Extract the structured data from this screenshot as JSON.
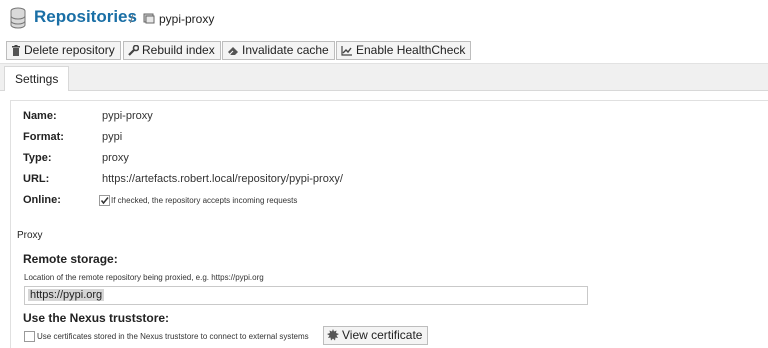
{
  "breadcrumb": {
    "title": "Repositories",
    "separator": "/",
    "item": "pypi-proxy"
  },
  "toolbar": {
    "delete_label": "Delete repository",
    "rebuild_label": "Rebuild index",
    "invalidate_label": "Invalidate cache",
    "healthcheck_label": "Enable HealthCheck"
  },
  "tabs": [
    {
      "label": "Settings",
      "active": true
    }
  ],
  "form": {
    "name_label": "Name:",
    "name_value": "pypi-proxy",
    "format_label": "Format:",
    "format_value": "pypi",
    "type_label": "Type:",
    "type_value": "proxy",
    "url_label": "URL:",
    "url_value": "https://artefacts.robert.local/repository/pypi-proxy/",
    "online_label": "Online:",
    "online_checked": true,
    "online_hint": "If checked, the repository accepts incoming requests"
  },
  "proxy": {
    "section_title": "Proxy",
    "remote_label": "Remote storage:",
    "remote_hint": "Location of the remote repository being proxied, e.g. https://pypi.org",
    "remote_value": "https://pypi.org",
    "truststore_label": "Use the Nexus truststore:",
    "truststore_checked": false,
    "truststore_hint": "Use certificates stored in the Nexus truststore to connect to external systems",
    "view_cert_label": "View certificate"
  },
  "icons": {
    "repositories": "database-icon",
    "item": "proxy-repo-icon",
    "delete": "trash-icon",
    "rebuild": "wrench-icon",
    "invalidate": "eraser-icon",
    "healthcheck": "chart-line-icon",
    "certificate": "certificate-icon"
  }
}
